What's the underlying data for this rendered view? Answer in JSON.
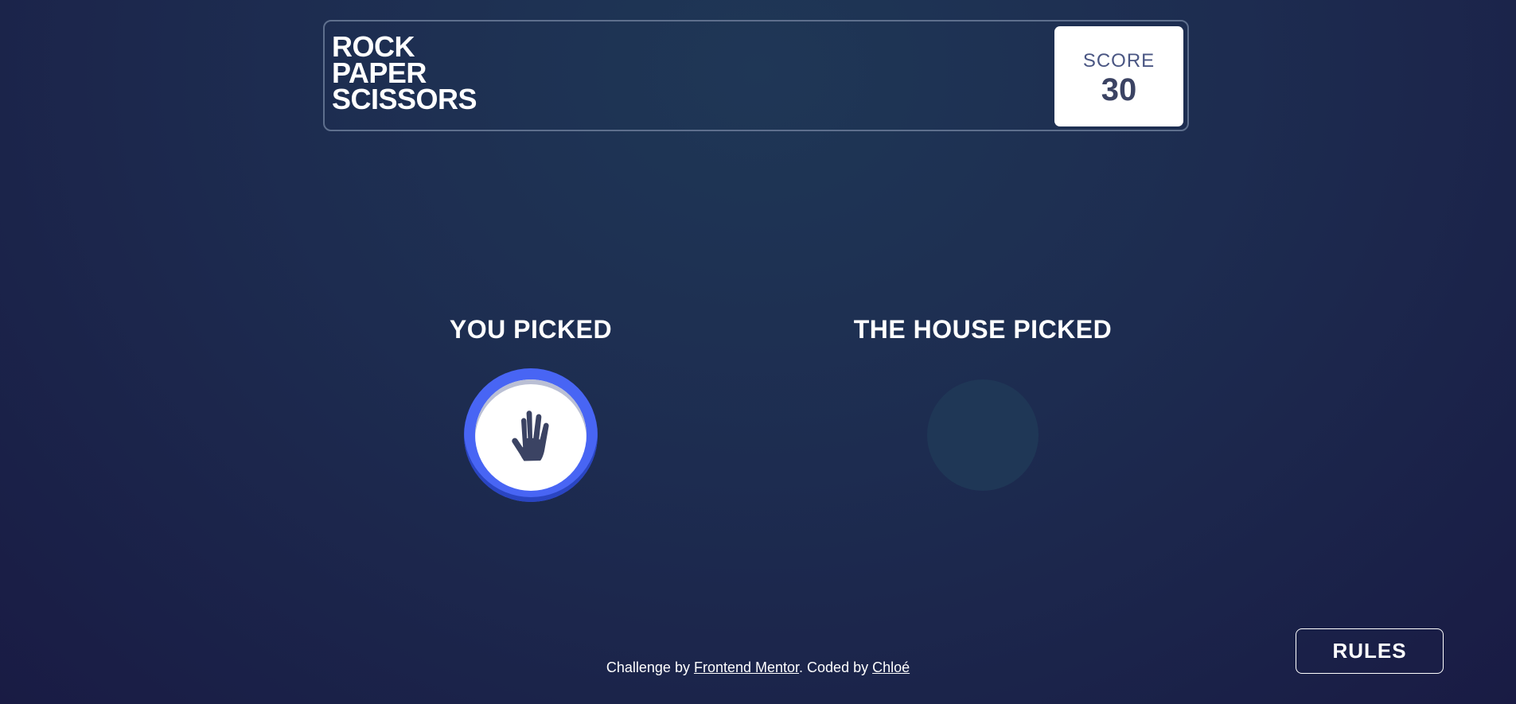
{
  "header": {
    "title_lines": [
      "ROCK",
      "PAPER",
      "SCISSORS"
    ],
    "score_label": "SCORE",
    "score_value": "30"
  },
  "game": {
    "player_label": "YOU PICKED",
    "house_label": "THE HOUSE PICKED",
    "player_pick": "paper",
    "player_pick_icon": "paper-hand-icon",
    "house_pick": null
  },
  "colors": {
    "paper_ring": "#4865f4",
    "background_dark": "#191b44",
    "score_text": "#3b4363",
    "house_placeholder": "#1f3756"
  },
  "footer": {
    "prefix": "Challenge by ",
    "mentor_link": "Frontend Mentor",
    "middle": ". Coded by ",
    "author_link": "Chloé"
  },
  "rules_button": "RULES"
}
